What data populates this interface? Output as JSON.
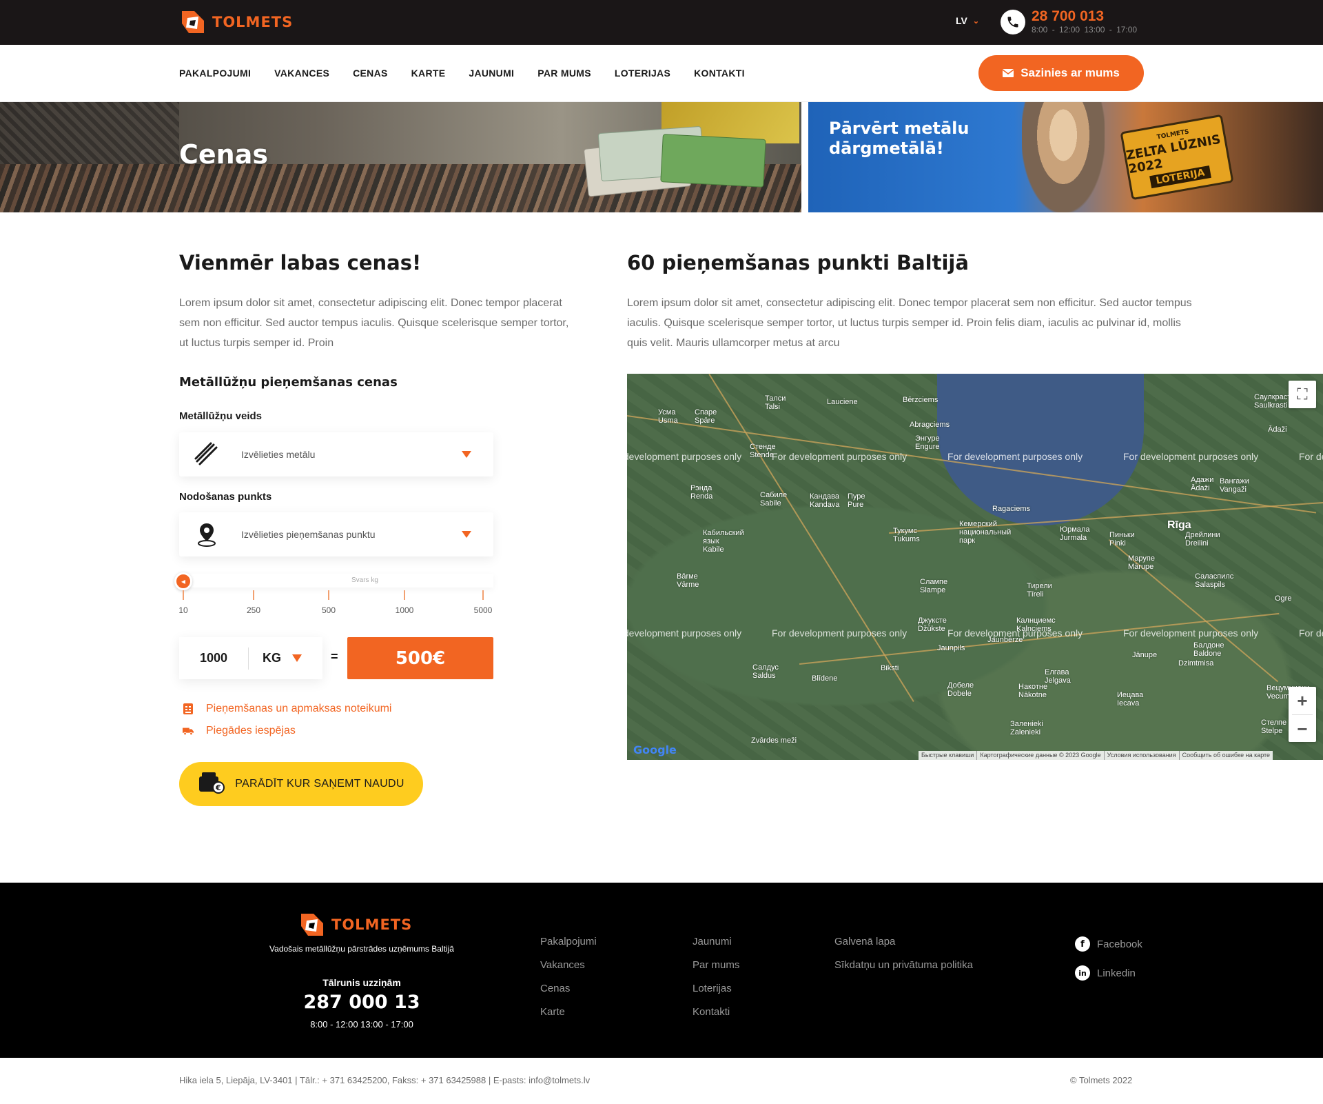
{
  "brand": {
    "name": "TOLMETS"
  },
  "header": {
    "lang": "LV",
    "phone": "28 700 013",
    "hours": "8:00 - 12:00   13:00 - 17:00"
  },
  "nav": {
    "items": [
      "PAKALPOJUMI",
      "VAKANCES",
      "CENAS",
      "KARTE",
      "JAUNUMI",
      "PAR MUMS",
      "LOTERIJAS",
      "KONTAKTI"
    ],
    "contact_button": "Sazinies ar mums"
  },
  "hero": {
    "title": "Cenas",
    "promo_text_line1": "Pārvērt metālu",
    "promo_text_line2": "dārgmetālā!",
    "badge_brand": "TOLMETS",
    "badge_line1": "ZELTA LŪZNIS 2022",
    "badge_line2": "LOTERIJA"
  },
  "prices": {
    "heading": "Vienmēr labas cenas!",
    "intro": "Lorem ipsum dolor sit amet, consectetur adipiscing elit. Donec tempor placerat sem non efficitur. Sed auctor tempus iaculis. Quisque scelerisque semper tortor, ut luctus turpis semper id. Proin",
    "calc_heading": "Metāllūžņu pieņemšanas cenas",
    "metal_label": "Metāllūžņu veids",
    "metal_placeholder": "Izvēlieties metālu",
    "point_label": "Nodošanas punkts",
    "point_placeholder": "Izvēlieties pieņemšanas punktu",
    "slider_label": "Svars kg",
    "slider_ticks": [
      "10",
      "250",
      "500",
      "1000",
      "5000"
    ],
    "qty_value": "1000",
    "qty_unit": "KG",
    "equals": "=",
    "price": "500€",
    "link_terms": "Pieņemšanas un apmaksas noteikumi",
    "link_delivery": "Piegādes iespējas",
    "money_button": "PARĀDĪT KUR SAŅEMT NAUDU"
  },
  "points": {
    "heading": "60 pieņemšanas punkti Baltijā",
    "intro": "Lorem ipsum dolor sit amet, consectetur adipiscing elit. Donec tempor placerat sem non efficitur. Sed auctor tempus iaculis. Quisque scelerisque semper tortor, ut luctus turpis semper id. Proin felis diam, iaculis ac pulvinar id, mollis quis velit. Mauris ullamcorper metus at arcu"
  },
  "map": {
    "watermark": "For development purposes only",
    "google": "Google",
    "attribution": [
      "Быстрые клавиши",
      "Картографические данные © 2023 Google",
      "Условия использования",
      "Сообщить об ошибке на карте"
    ],
    "cities": [
      {
        "n": "Талси\nTalsi"
      },
      {
        "n": "Lauciene"
      },
      {
        "n": "Bērzciems"
      },
      {
        "n": "Abragciems"
      },
      {
        "n": "Энгуре\nEngure"
      },
      {
        "n": "Стенде\nStende"
      },
      {
        "n": "Рэнда\nRenda"
      },
      {
        "n": "Сабиле\nSabile"
      },
      {
        "n": "Кандава\nKandava"
      },
      {
        "n": "Пуре\nPure"
      },
      {
        "n": "Ragaciems"
      },
      {
        "n": "Кабильский\nязык\nKabile"
      },
      {
        "n": "Тукумс\nTukums"
      },
      {
        "n": "Кемерский\nнациональный\nпарк"
      },
      {
        "n": "Юрмала\nJurmala"
      },
      {
        "n": "Пиньки\nPinki"
      },
      {
        "n": "Rīga"
      },
      {
        "n": "Дрейлини\nDreilini"
      },
      {
        "n": "Марупе\nMārupe"
      },
      {
        "n": "Вārме\nVārme"
      },
      {
        "n": "Слампе\nSlampe"
      },
      {
        "n": "Тирели\nTīreli"
      },
      {
        "n": "Саласпилс\nSalaspils"
      },
      {
        "n": "Джуксте\nDžūkste"
      },
      {
        "n": "Калнциемс\nKalnciems"
      },
      {
        "n": "Jaunbērze"
      },
      {
        "n": "Jaunpils"
      },
      {
        "n": "Салдус\nSaldus"
      },
      {
        "n": "Biksti"
      },
      {
        "n": "Blīdene"
      },
      {
        "n": "Елгава\nJelgava"
      },
      {
        "n": "Добеле\nDobele"
      },
      {
        "n": "Накотне\nNākotne"
      },
      {
        "n": "Иецава\nIecava"
      },
      {
        "n": "Балдоне\nBaldone"
      },
      {
        "n": "Jānupe"
      },
      {
        "n": "Dzimtmisa"
      },
      {
        "n": "Вецумниеки\nVecumnieki"
      },
      {
        "n": "Стелпе\nStelpe"
      },
      {
        "n": "Заленieki\nZalenieki"
      },
      {
        "n": "Zvārdes meži"
      },
      {
        "n": "Саулкрасты\nSaulkrasti"
      },
      {
        "n": "Ādaži"
      },
      {
        "n": "Адажи\nĀdaži"
      },
      {
        "n": "Вангажи\nVangaži"
      },
      {
        "n": "Ogre"
      },
      {
        "n": "Усма\nUsma"
      },
      {
        "n": "Спаре\nSpāre"
      }
    ]
  },
  "footer": {
    "tagline": "Vadošais metāllūžņu pārstrādes uzņēmums Baltijā",
    "phone_label": "Tālrunis uzziņām",
    "phone": "287 000 13",
    "hours": "8:00 - 12:00 13:00 - 17:00",
    "col1": [
      "Pakalpojumi",
      "Vakances",
      "Cenas",
      "Karte"
    ],
    "col2": [
      "Jaunumi",
      "Par mums",
      "Loterijas",
      "Kontakti"
    ],
    "col3": [
      "Galvenā lapa",
      "Sīkdatņu un privātuma politika"
    ],
    "facebook": "Facebook",
    "linkedin": "Linkedin",
    "address": "Hika iela 5, Liepāja, LV-3401 | Tālr.: + 371 63425200, Fakss: + 371 63425988 | E-pasts: info@tolmets.lv",
    "copyright": "© Tolmets 2022"
  },
  "colors": {
    "accent": "#f26522",
    "yellow": "#fecc1f",
    "dark": "#1a1617"
  }
}
